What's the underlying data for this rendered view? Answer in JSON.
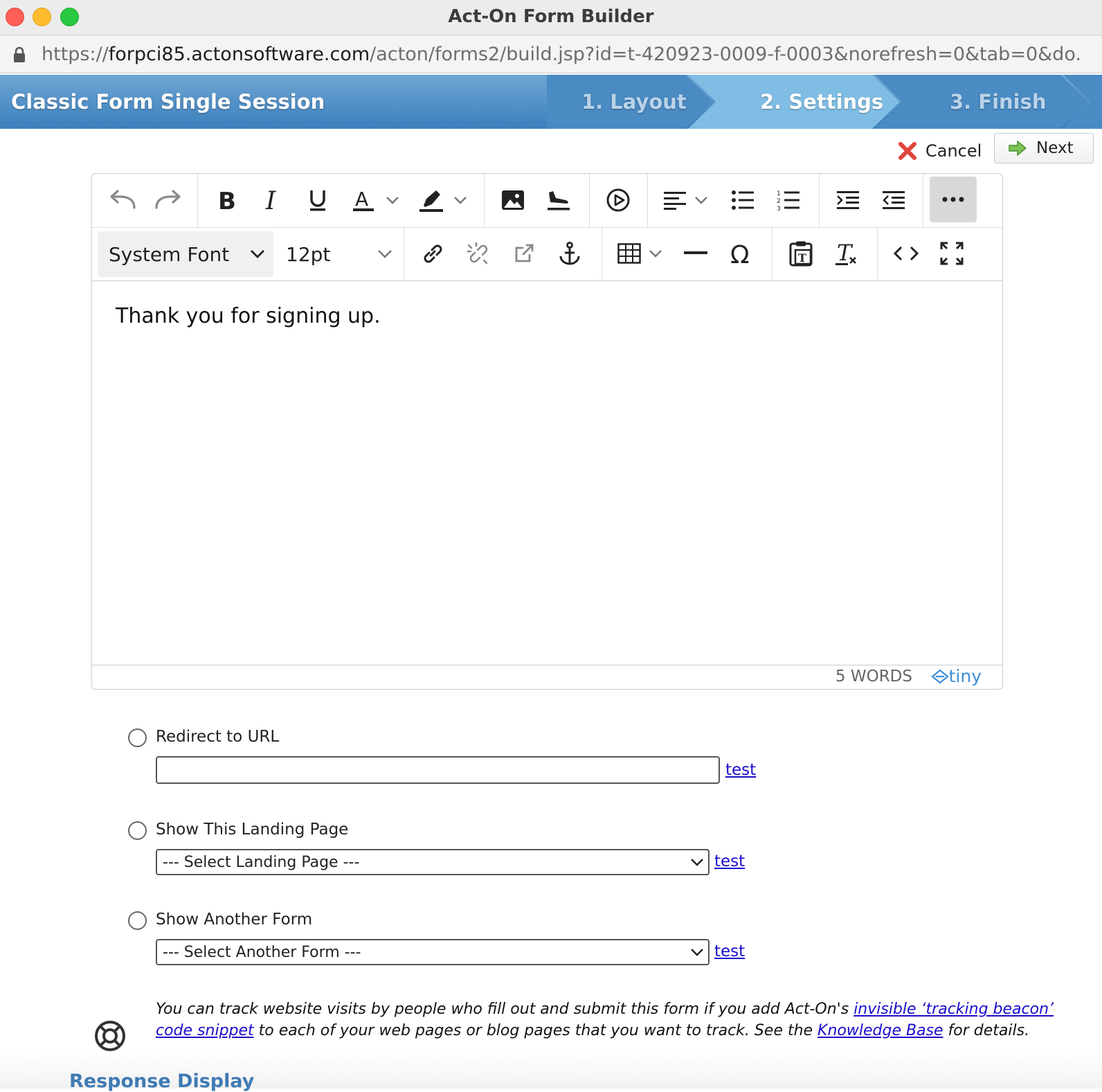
{
  "window": {
    "title": "Act-On Form Builder",
    "url_prefix": "https://",
    "url_host": "forpci85.actonsoftware.com",
    "url_path": "/acton/forms2/build.jsp?id=t-420923-0009-f-0003&norefresh=0&tab=0&do..."
  },
  "wizard": {
    "title": "Classic Form Single Session",
    "steps": [
      {
        "label": "1. Layout",
        "state": "inactive"
      },
      {
        "label": "2. Settings",
        "state": "active"
      },
      {
        "label": "3. Finish",
        "state": "inactive"
      }
    ]
  },
  "actions": {
    "cancel_label": "Cancel",
    "next_label": "Next"
  },
  "editor": {
    "font_family": "System Font",
    "font_size": "12pt",
    "content": "Thank you for signing up.",
    "word_count": "5 WORDS",
    "brand": "tiny",
    "toolbar_icons": [
      "undo-icon",
      "redo-icon",
      "bold-icon",
      "italic-icon",
      "underline-icon",
      "text-color-icon",
      "highlight-icon",
      "image-icon",
      "landing-icon",
      "media-icon",
      "align-icon",
      "bullet-list-icon",
      "numbered-list-icon",
      "indent-icon",
      "outdent-icon",
      "more-icon",
      "link-icon",
      "unlink-icon",
      "open-link-icon",
      "anchor-icon",
      "table-icon",
      "horizontal-rule-icon",
      "special-char-icon",
      "paste-text-icon",
      "clear-format-icon",
      "code-icon",
      "fullscreen-icon"
    ]
  },
  "options": {
    "redirect": {
      "label": "Redirect to URL",
      "value": "",
      "test_label": "test"
    },
    "landing_page": {
      "label": "Show This Landing Page",
      "selected": "--- Select Landing Page ---",
      "test_label": "test"
    },
    "another_form": {
      "label": "Show Another Form",
      "selected": "--- Select Another Form ---",
      "test_label": "test"
    }
  },
  "note": {
    "part1": "You can track website visits by people who fill out and submit this form if you add Act-On's ",
    "link1": "invisible ‘tracking beacon’ code snippet",
    "part2": " to each of your web pages or blog pages that you want to track. See the ",
    "link2": "Knowledge Base",
    "part3": " for details."
  },
  "section": {
    "heading": "Response Display"
  },
  "colors": {
    "header_blue": "#3a7fbc",
    "link": "#1a0dcc",
    "heading_blue": "#3f7ab3"
  }
}
